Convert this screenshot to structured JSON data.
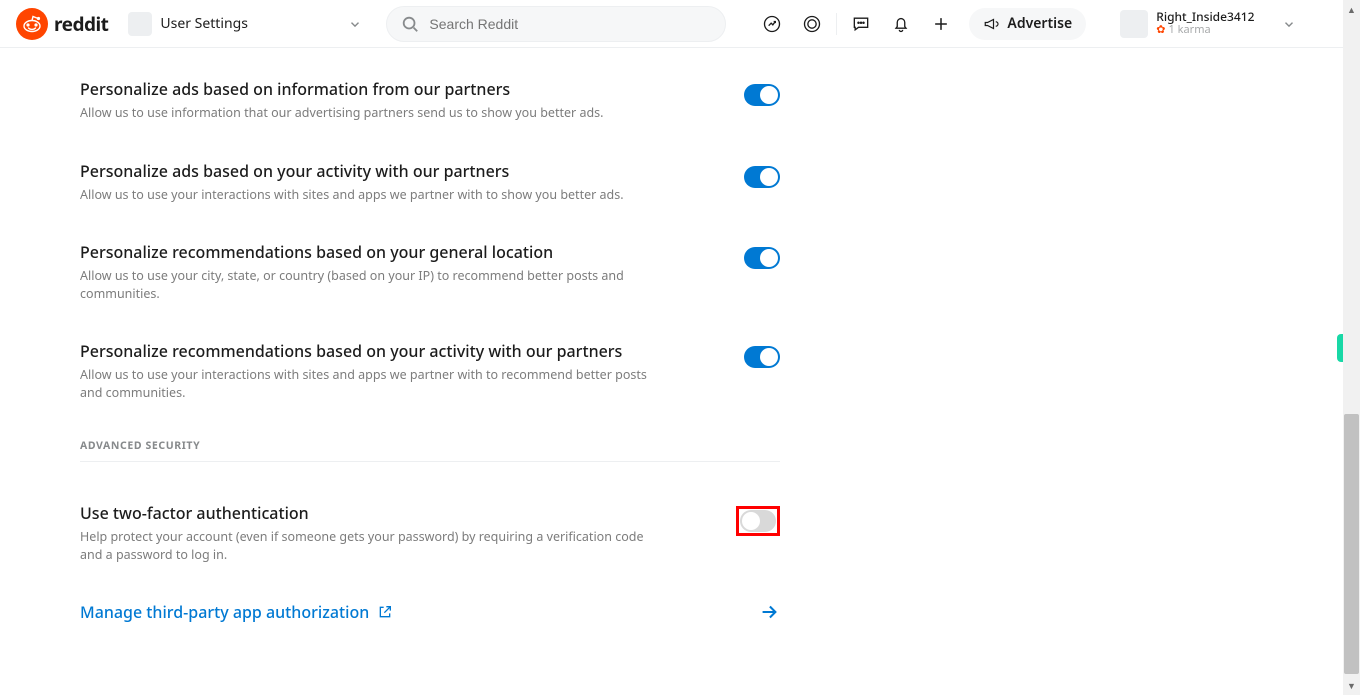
{
  "brand": {
    "word": "reddit"
  },
  "community": {
    "label": "User Settings"
  },
  "search": {
    "placeholder": "Search Reddit"
  },
  "header": {
    "advertise": "Advertise"
  },
  "user": {
    "name": "Right_Inside3412",
    "karma": "1 karma"
  },
  "settings": [
    {
      "title": "Personalize ads based on information from our partners",
      "desc": "Allow us to use information that our advertising partners send us to show you better ads.",
      "on": true
    },
    {
      "title": "Personalize ads based on your activity with our partners",
      "desc": "Allow us to use your interactions with sites and apps we partner with to show you better ads.",
      "on": true
    },
    {
      "title": "Personalize recommendations based on your general location",
      "desc": "Allow us to use your city, state, or country (based on your IP) to recommend better posts and communities.",
      "on": true
    },
    {
      "title": "Personalize recommendations based on your activity with our partners",
      "desc": "Allow us to use your interactions with sites and apps we partner with to recommend better posts and communities.",
      "on": true
    }
  ],
  "section": {
    "advanced": "ADVANCED SECURITY"
  },
  "twofa": {
    "title": "Use two-factor authentication",
    "desc": "Help protect your account (even if someone gets your password) by requiring a verification code and a password to log in.",
    "on": false
  },
  "link": {
    "thirdparty": "Manage third-party app authorization"
  }
}
